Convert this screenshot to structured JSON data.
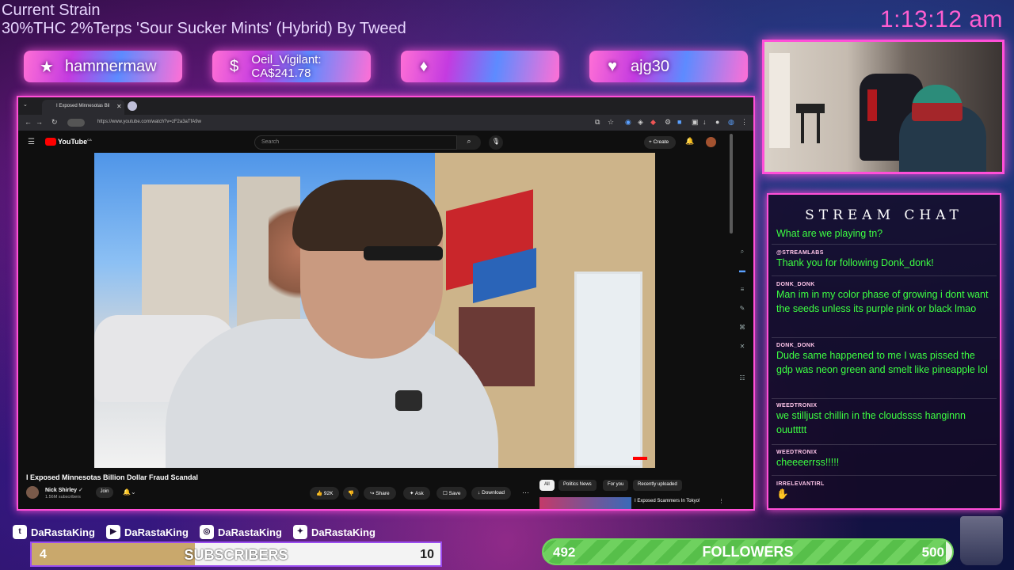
{
  "overlay": {
    "strain_title": "Current Strain",
    "strain_desc": "30%THC 2%Terps 'Sour Sucker Mints' (Hybrid) By  Tweed",
    "clock": "1:13:12 am"
  },
  "alerts": [
    {
      "icon": "star-icon",
      "glyph": "★",
      "text": "hammermaw"
    },
    {
      "icon": "dollar-icon",
      "glyph": "$",
      "text": "Oeil_Vigilant: CA$241.78"
    },
    {
      "icon": "gem-icon",
      "glyph": "♦",
      "text": ""
    },
    {
      "icon": "heart-icon",
      "glyph": "♥",
      "text": "ajg30"
    }
  ],
  "chat": {
    "title": "STREAM CHAT",
    "messages": [
      {
        "user": "",
        "text": "What are we playing tn?"
      },
      {
        "user": "@STREAMLABS",
        "text": "Thank you for following Donk_donk!"
      },
      {
        "user": "DONK_DONK",
        "text": "Man im in my color phase of growing i dont want the seeds unless its purple pink or black lmao"
      },
      {
        "user": "DONK_DONK",
        "text": "Dude same happened to me I was pissed the gdp was neon green and smelt like pineapple lol"
      },
      {
        "user": "WEEDTRONIX",
        "text": "we stilljust chillin in the cloudssss hanginnn ouuttttt"
      },
      {
        "user": "WEEDTRONIX",
        "text": "cheeeerrss!!!!!"
      },
      {
        "user": "IRRELEVANTIRL",
        "text": ""
      }
    ],
    "text_color": "#3dff42"
  },
  "browser": {
    "tab_title": "I Exposed Minnesotas Bil",
    "url": "https://www.youtube.com/watch?v=zF2a3aTfA9w",
    "search_placeholder": "Search",
    "create_label": "Create",
    "logo_text": "YouTube",
    "logo_region": "CA"
  },
  "video": {
    "title": "I Exposed Minnesotas Billion Dollar Fraud Scandal",
    "channel": "Nick Shirley",
    "subscribers": "1.56M subscribers",
    "join_label": "Join",
    "likes": "92K",
    "share_label": "Share",
    "ask_label": "Ask",
    "save_label": "Save",
    "download_label": "Download"
  },
  "chips": [
    "All",
    "Politics News",
    "For you",
    "Recently uploaded"
  ],
  "recommended": {
    "title": "I Exposed Scammers In Tokyo!"
  },
  "socials": [
    {
      "icon": "twitch-icon",
      "glyph": "t",
      "handle": "DaRastaKing"
    },
    {
      "icon": "youtube-icon",
      "glyph": "▶",
      "handle": "DaRastaKing"
    },
    {
      "icon": "instagram-icon",
      "glyph": "◎",
      "handle": "DaRastaKing"
    },
    {
      "icon": "twitter-icon",
      "glyph": "✦",
      "handle": "DaRastaKing"
    }
  ],
  "subscribers_goal": {
    "label": "SUBSCRIBERS",
    "current": "4",
    "goal": "10",
    "progress": 0.4
  },
  "followers_goal": {
    "label": "FOLLOWERS",
    "current": "492",
    "goal": "500",
    "progress": 0.984
  },
  "colors": {
    "accent": "#ff4fd8",
    "clock": "#ff5ed0",
    "chat_text": "#3dff42"
  }
}
